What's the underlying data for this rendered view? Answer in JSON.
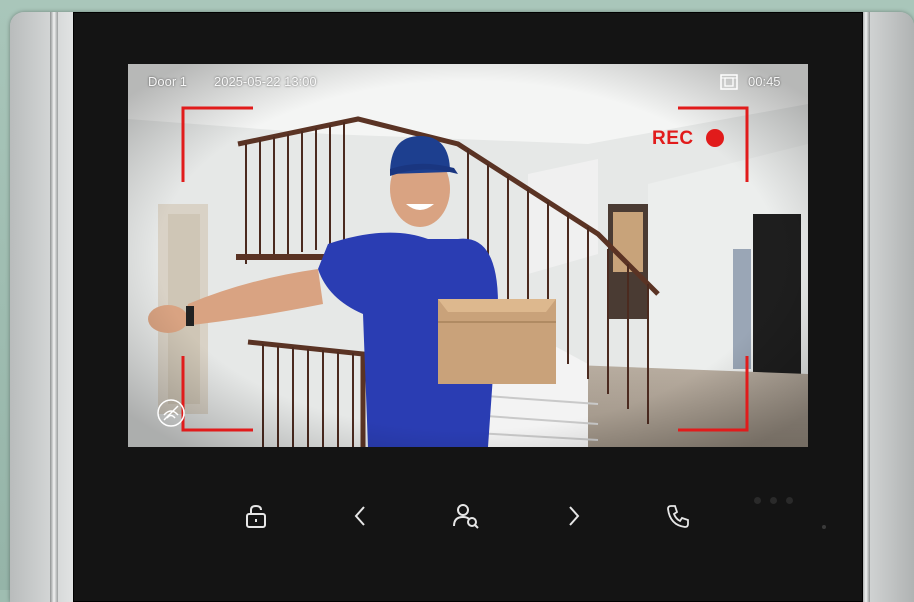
{
  "overlay": {
    "door_label": "Door 1",
    "datetime": "2025-05-22  13:00",
    "record_timer": "00:45",
    "rec_label": "REC"
  },
  "icons": {
    "unlock": "lock-icon",
    "previous": "chevron-left-icon",
    "search_user": "user-search-icon",
    "next": "chevron-right-icon",
    "call": "phone-icon",
    "recording": "record-file-icon",
    "signal": "signal-icon"
  },
  "colors": {
    "rec": "#e11b1b",
    "bezel": "#141414",
    "button_icon": "#e6e6e6"
  }
}
